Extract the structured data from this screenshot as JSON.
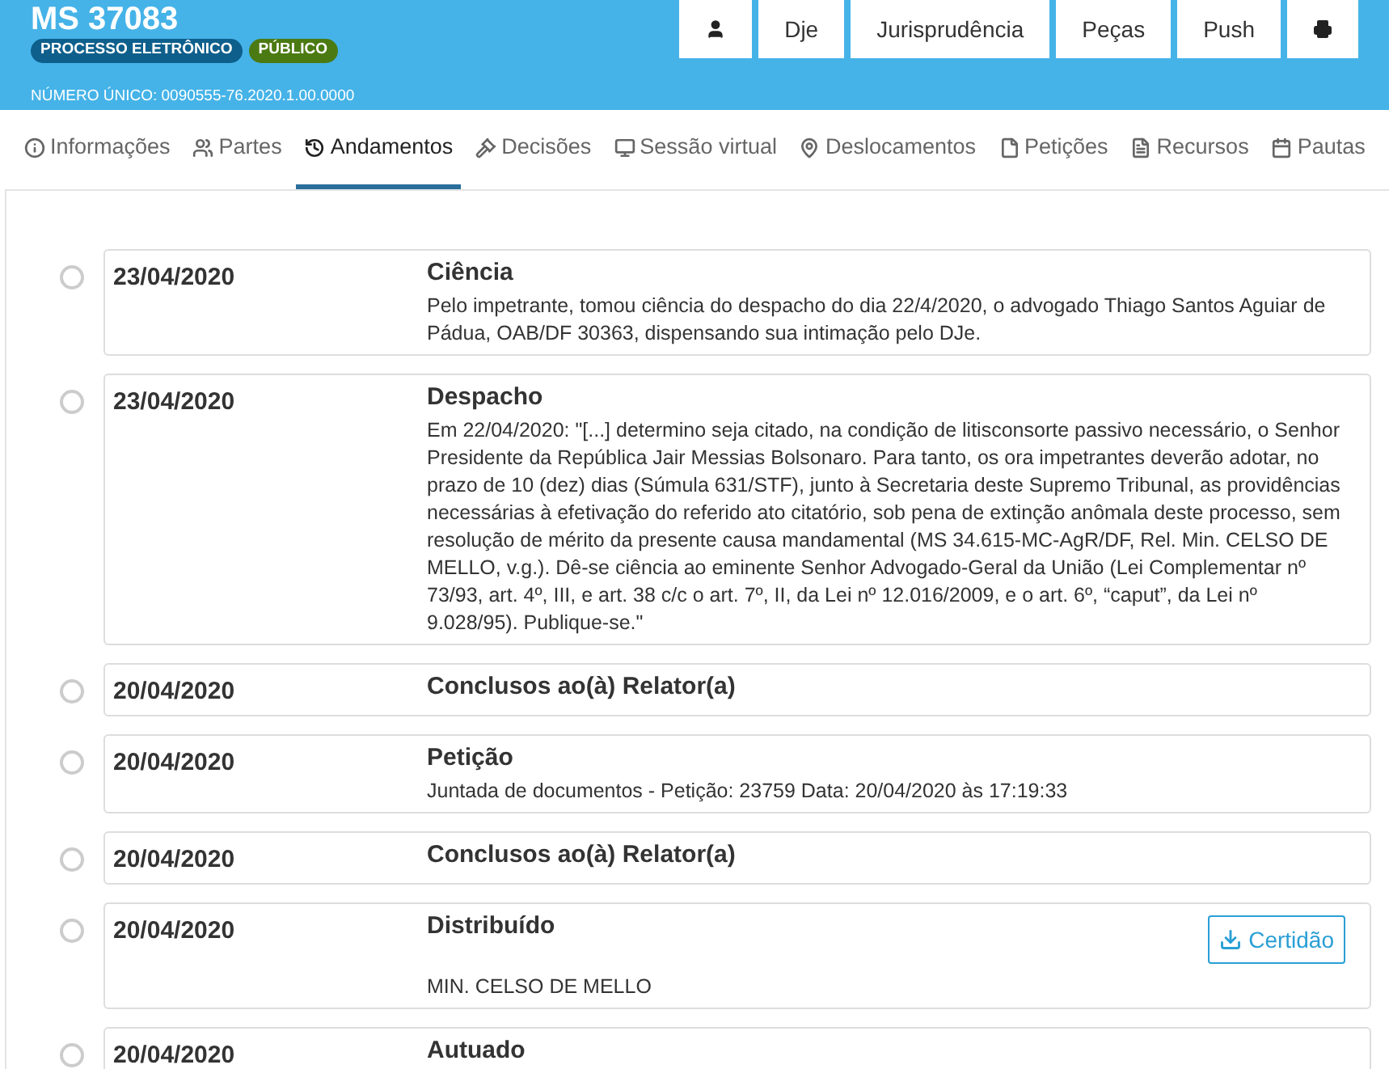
{
  "header": {
    "title": "MS 37083",
    "badges": [
      {
        "label": "PROCESSO ELETRÔNICO",
        "color": "#0e5f8c"
      },
      {
        "label": "PÚBLICO",
        "color": "#4b7a12"
      }
    ],
    "numero_unico": "NÚMERO ÚNICO: 0090555-76.2020.1.00.0000",
    "buttons": [
      {
        "kind": "user"
      },
      {
        "kind": "text",
        "label": "Dje"
      },
      {
        "kind": "text",
        "label": "Jurisprudência"
      },
      {
        "kind": "text",
        "label": "Peças"
      },
      {
        "kind": "text",
        "label": "Push"
      },
      {
        "kind": "print"
      }
    ]
  },
  "tabs": [
    {
      "label": "Informações",
      "selected": false
    },
    {
      "label": "Partes",
      "selected": false
    },
    {
      "label": "Andamentos",
      "selected": true
    },
    {
      "label": "Decisões",
      "selected": false
    },
    {
      "label": "Sessão virtual",
      "selected": false
    },
    {
      "label": "Deslocamentos",
      "selected": false
    },
    {
      "label": "Petições",
      "selected": false
    },
    {
      "label": "Recursos",
      "selected": false
    },
    {
      "label": "Pautas",
      "selected": false
    }
  ],
  "timeline": [
    {
      "date": "23/04/2020",
      "title": "Ciência",
      "text": "Pelo impetrante, tomou ciência do despacho do dia 22/4/2020, o advogado Thiago Santos Aguiar de Pádua, OAB/DF 30363, dispensando sua intimação pelo DJe."
    },
    {
      "date": "23/04/2020",
      "title": "Despacho",
      "text": "Em 22/04/2020: \"[...] determino seja citado, na condição de litisconsorte passivo necessário, o Senhor Presidente da República Jair Messias Bolsonaro. Para tanto, os ora impetrantes deverão adotar, no prazo de 10 (dez) dias (Súmula 631/STF), junto à Secretaria deste Supremo Tribunal, as providências necessárias à efetivação do referido ato citatório, sob pena de extinção anômala deste processo, sem resolução de mérito da presente causa mandamental (MS 34.615-MC-AgR/DF, Rel. Min. CELSO DE MELLO, v.g.). Dê-se ciência ao eminente Senhor Advogado-Geral da União (Lei Complementar nº 73/93, art. 4º, III, e art. 38 c/c o art. 7º, II, da Lei nº 12.016/2009, e o art. 6º, “caput”, da Lei nº 9.028/95). Publique-se.\""
    },
    {
      "date": "20/04/2020",
      "title": "Conclusos ao(à) Relator(a)"
    },
    {
      "date": "20/04/2020",
      "title": "Petição",
      "text": "Juntada de documentos - Petição: 23759 Data: 20/04/2020 às 17:19:33"
    },
    {
      "date": "20/04/2020",
      "title": "Conclusos ao(à) Relator(a)"
    },
    {
      "date": "20/04/2020",
      "title": "Distribuído",
      "button": "Certidão",
      "text": "MIN. CELSO DE MELLO"
    },
    {
      "date": "20/04/2020",
      "title": "Autuado"
    }
  ]
}
